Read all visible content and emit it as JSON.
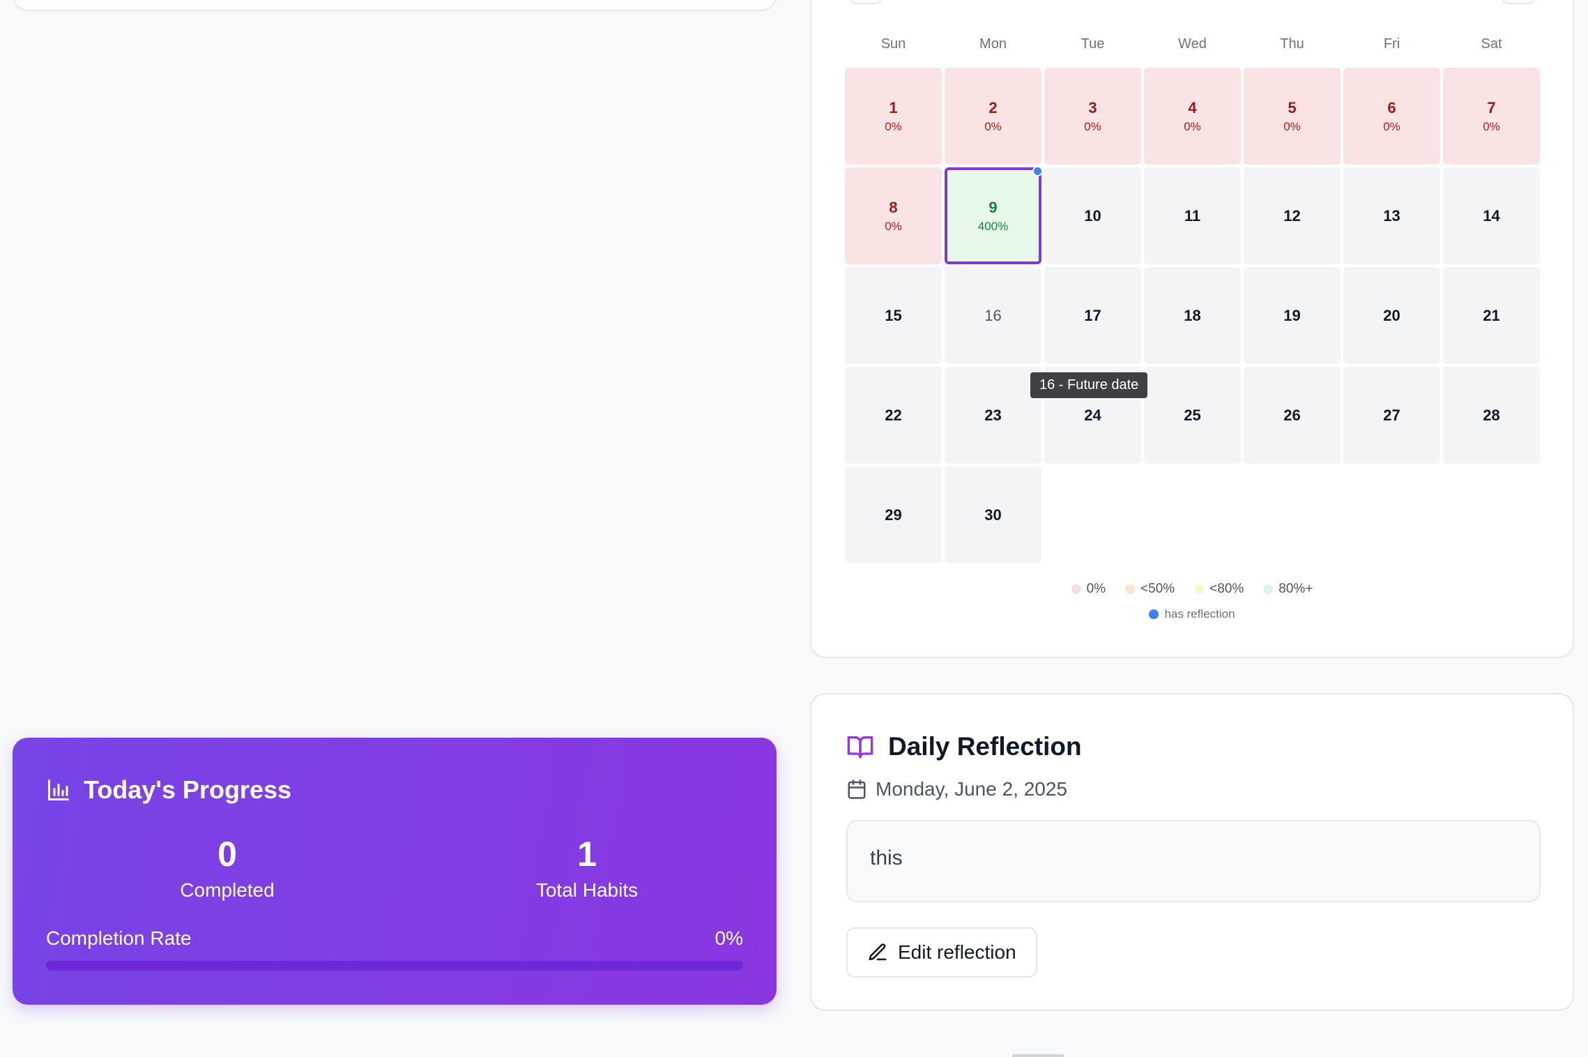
{
  "calendar": {
    "weekdays": [
      "Sun",
      "Mon",
      "Tue",
      "Wed",
      "Thu",
      "Fri",
      "Sat"
    ],
    "days": [
      {
        "day": "1",
        "pct": "0%",
        "status": "red"
      },
      {
        "day": "2",
        "pct": "0%",
        "status": "red"
      },
      {
        "day": "3",
        "pct": "0%",
        "status": "red"
      },
      {
        "day": "4",
        "pct": "0%",
        "status": "red"
      },
      {
        "day": "5",
        "pct": "0%",
        "status": "red"
      },
      {
        "day": "6",
        "pct": "0%",
        "status": "red"
      },
      {
        "day": "7",
        "pct": "0%",
        "status": "red"
      },
      {
        "day": "8",
        "pct": "0%",
        "status": "red"
      },
      {
        "day": "9",
        "pct": "400%",
        "status": "green",
        "has_reflection": true,
        "selected": true
      },
      {
        "day": "10",
        "status": "future"
      },
      {
        "day": "11",
        "status": "future"
      },
      {
        "day": "12",
        "status": "future"
      },
      {
        "day": "13",
        "status": "future"
      },
      {
        "day": "14",
        "status": "future"
      },
      {
        "day": "15",
        "status": "future"
      },
      {
        "day": "16",
        "status": "future",
        "hovered": true
      },
      {
        "day": "17",
        "status": "future"
      },
      {
        "day": "18",
        "status": "future"
      },
      {
        "day": "19",
        "status": "future"
      },
      {
        "day": "20",
        "status": "future"
      },
      {
        "day": "21",
        "status": "future"
      },
      {
        "day": "22",
        "status": "future"
      },
      {
        "day": "23",
        "status": "future"
      },
      {
        "day": "24",
        "status": "future"
      },
      {
        "day": "25",
        "status": "future"
      },
      {
        "day": "26",
        "status": "future"
      },
      {
        "day": "27",
        "status": "future"
      },
      {
        "day": "28",
        "status": "future"
      },
      {
        "day": "29",
        "status": "future"
      },
      {
        "day": "30",
        "status": "future"
      }
    ],
    "tooltip": "16 - Future date",
    "legend": [
      {
        "label": "0%",
        "color": "#fbdcdc"
      },
      {
        "label": "<50%",
        "color": "#fde4cf"
      },
      {
        "label": "<80%",
        "color": "#fdf6c8"
      },
      {
        "label": "80%+",
        "color": "#dcf7e1"
      }
    ],
    "legend_reflection": {
      "label": "has reflection",
      "color": "#3b82f6"
    }
  },
  "progress": {
    "title": "Today's Progress",
    "completed_value": "0",
    "completed_label": "Completed",
    "total_value": "1",
    "total_label": "Total Habits",
    "rate_label": "Completion Rate",
    "rate_value": "0%",
    "rate_fraction": 0
  },
  "reflection": {
    "title": "Daily Reflection",
    "date": "Monday, June 2, 2025",
    "text": "this",
    "edit_label": "Edit reflection"
  },
  "icons": {
    "progress": "bar-chart-icon",
    "reflection": "book-open-icon",
    "date": "calendar-icon",
    "edit": "pencil-icon"
  }
}
